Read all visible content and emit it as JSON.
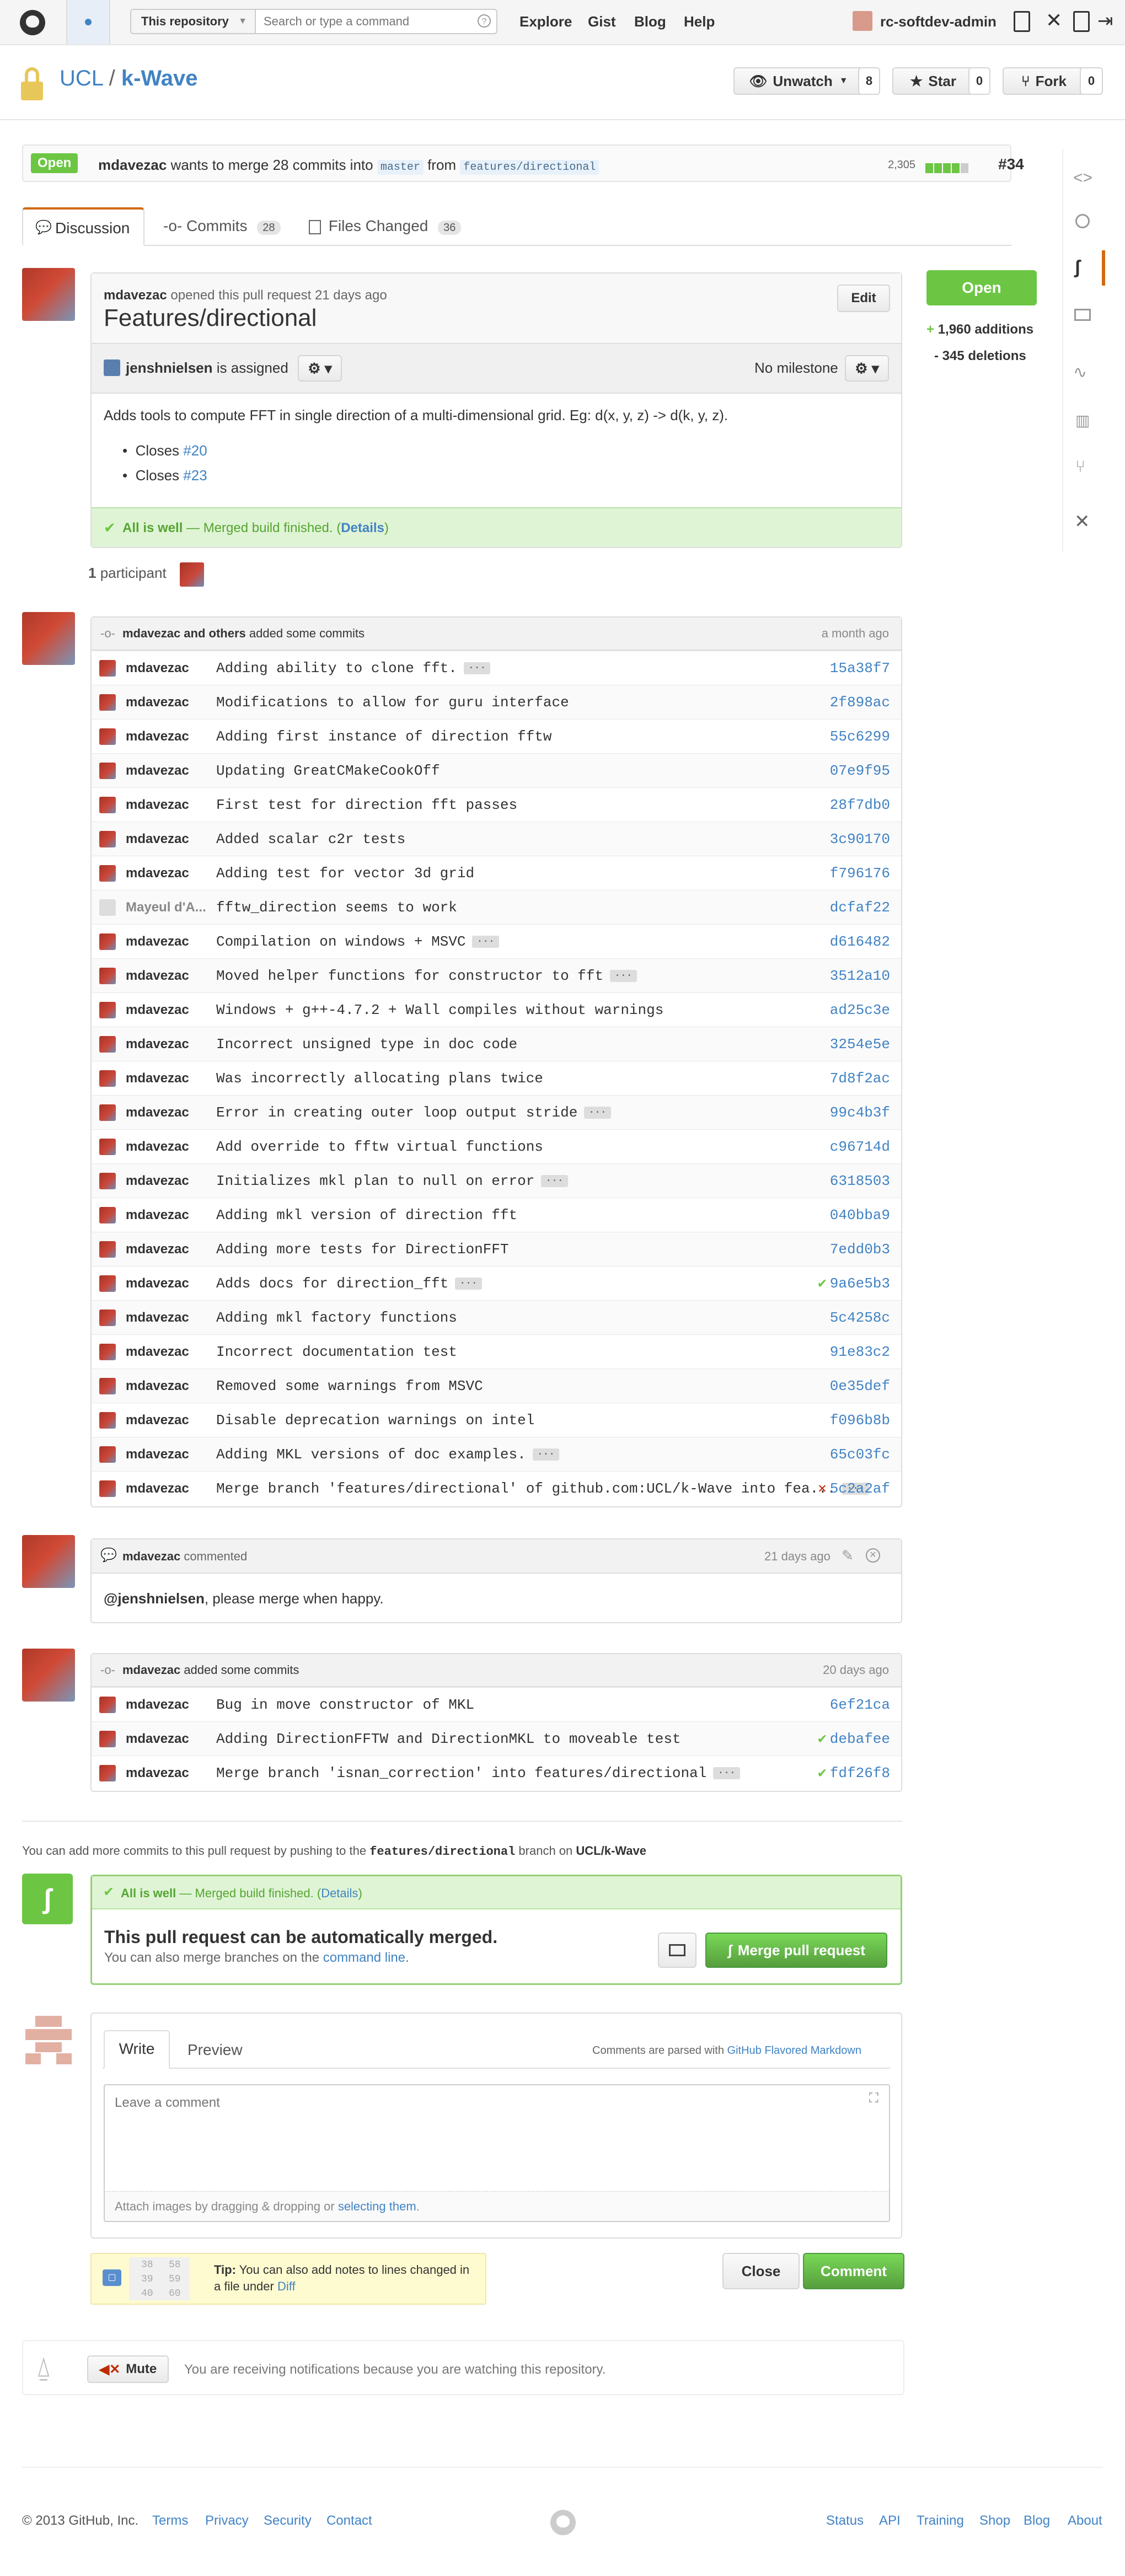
{
  "header": {
    "scope_label": "This repository",
    "search_placeholder": "Search or type a command",
    "nav": [
      "Explore",
      "Gist",
      "Blog",
      "Help"
    ],
    "username": "rc-softdev-admin"
  },
  "repo": {
    "owner": "UCL",
    "separator": "/",
    "name": "k-Wave",
    "unwatch_label": "Unwatch",
    "unwatch_count": "8",
    "star_label": "Star",
    "star_count": "0",
    "fork_label": "Fork",
    "fork_count": "0"
  },
  "pr_bar": {
    "state": "Open",
    "author": "mdavezac",
    "text_mid": "wants to merge 28 commits into",
    "base": "master",
    "from_text": "from",
    "head": "features/directional",
    "diff_count": "2,305",
    "number": "#34"
  },
  "tabs": {
    "discussion": "Discussion",
    "commits": "Commits",
    "commits_count": "28",
    "files": "Files Changed",
    "files_count": "36"
  },
  "opening": {
    "author": "mdavezac",
    "meta": "opened this pull request 21 days ago",
    "title": "Features/directional",
    "edit_label": "Edit",
    "assignee": "jenshnielsen",
    "assigned_text": "is assigned",
    "milestone": "No milestone",
    "body": "Adds tools to compute FFT in single direction of a multi-dimensional grid. Eg: d(x, y, z) -> d(k, y, z).",
    "closes": [
      {
        "prefix": "Closes",
        "ref": "#20"
      },
      {
        "prefix": "Closes",
        "ref": "#23"
      }
    ],
    "status_bold": "All is well",
    "status_text": "— Merged build finished. (",
    "status_link": "Details",
    "status_end": ")"
  },
  "side": {
    "state_button": "Open",
    "additions": "1,960 additions",
    "deletions": "- 345 deletions"
  },
  "participants": {
    "count": "1",
    "label": "participant"
  },
  "commit_group1": {
    "header": "mdavezac and others",
    "header_suffix": "added some commits",
    "time": "a month ago",
    "commits": [
      {
        "author": "mdavezac",
        "msg": "Adding ability to clone fft.",
        "sha": "15a38f7",
        "ell": true,
        "status": ""
      },
      {
        "author": "mdavezac",
        "msg": "Modifications to allow for guru interface",
        "sha": "2f898ac",
        "ell": false,
        "status": ""
      },
      {
        "author": "mdavezac",
        "msg": "Adding first instance of direction fftw",
        "sha": "55c6299",
        "ell": false,
        "status": ""
      },
      {
        "author": "mdavezac",
        "msg": "Updating GreatCMakeCookOff",
        "sha": "07e9f95",
        "ell": false,
        "status": ""
      },
      {
        "author": "mdavezac",
        "msg": "First test for direction fft passes",
        "sha": "28f7db0",
        "ell": false,
        "status": ""
      },
      {
        "author": "mdavezac",
        "msg": "Added scalar c2r tests",
        "sha": "3c90170",
        "ell": false,
        "status": ""
      },
      {
        "author": "mdavezac",
        "msg": "Adding test for vector 3d grid",
        "sha": "f796176",
        "ell": false,
        "status": ""
      },
      {
        "author": "Mayeul d'A...",
        "msg": "fftw_direction seems to work",
        "sha": "dcfaf22",
        "ell": false,
        "status": "",
        "gray": true
      },
      {
        "author": "mdavezac",
        "msg": "Compilation on windows + MSVC",
        "sha": "d616482",
        "ell": true,
        "status": ""
      },
      {
        "author": "mdavezac",
        "msg": "Moved helper functions for constructor to fft",
        "sha": "3512a10",
        "ell": true,
        "status": ""
      },
      {
        "author": "mdavezac",
        "msg": "Windows + g++-4.7.2 + Wall compiles without warnings",
        "sha": "ad25c3e",
        "ell": false,
        "status": ""
      },
      {
        "author": "mdavezac",
        "msg": "Incorrect unsigned type in doc code",
        "sha": "3254e5e",
        "ell": false,
        "status": ""
      },
      {
        "author": "mdavezac",
        "msg": "Was incorrectly allocating plans twice",
        "sha": "7d8f2ac",
        "ell": false,
        "status": ""
      },
      {
        "author": "mdavezac",
        "msg": "Error in creating outer loop output stride",
        "sha": "99c4b3f",
        "ell": true,
        "status": ""
      },
      {
        "author": "mdavezac",
        "msg": "Add override to fftw virtual functions",
        "sha": "c96714d",
        "ell": false,
        "status": ""
      },
      {
        "author": "mdavezac",
        "msg": "Initializes mkl plan to null on error",
        "sha": "6318503",
        "ell": true,
        "status": ""
      },
      {
        "author": "mdavezac",
        "msg": "Adding mkl version of direction fft",
        "sha": "040bba9",
        "ell": false,
        "status": ""
      },
      {
        "author": "mdavezac",
        "msg": "Adding more tests for DirectionFFT",
        "sha": "7edd0b3",
        "ell": false,
        "status": ""
      },
      {
        "author": "mdavezac",
        "msg": "Adds docs for direction_fft",
        "sha": "9a6e5b3",
        "ell": true,
        "status": "ok"
      },
      {
        "author": "mdavezac",
        "msg": "Adding mkl factory functions",
        "sha": "5c4258c",
        "ell": false,
        "status": ""
      },
      {
        "author": "mdavezac",
        "msg": "Incorrect documentation test",
        "sha": "91e83c2",
        "ell": false,
        "status": ""
      },
      {
        "author": "mdavezac",
        "msg": "Removed some warnings from MSVC",
        "sha": "0e35def",
        "ell": false,
        "status": ""
      },
      {
        "author": "mdavezac",
        "msg": "Disable deprecation warnings on intel",
        "sha": "f096b8b",
        "ell": false,
        "status": ""
      },
      {
        "author": "mdavezac",
        "msg": "Adding MKL versions of doc examples.",
        "sha": "65c03fc",
        "ell": true,
        "status": ""
      },
      {
        "author": "mdavezac",
        "msg": "Merge branch 'features/directional' of github.com:UCL/k-Wave into fea...",
        "sha": "5c2a2af",
        "ell": true,
        "status": "fail"
      }
    ]
  },
  "comment": {
    "author": "mdavezac",
    "action": "commented",
    "time": "21 days ago",
    "mention": "@jenshnielsen",
    "body": ", please merge when happy."
  },
  "commit_group2": {
    "header": "mdavezac",
    "header_suffix": "added some commits",
    "time": "20 days ago",
    "commits": [
      {
        "author": "mdavezac",
        "msg": "Bug in move constructor of MKL",
        "sha": "6ef21ca",
        "ell": false,
        "status": ""
      },
      {
        "author": "mdavezac",
        "msg": "Adding DirectionFFTW and DirectionMKL to moveable test",
        "sha": "debafee",
        "ell": false,
        "status": "ok"
      },
      {
        "author": "mdavezac",
        "msg": "Merge branch 'isnan_correction' into features/directional",
        "sha": "fdf26f8",
        "ell": true,
        "status": "ok"
      }
    ]
  },
  "merge": {
    "hint_pre": "You can add more commits to this pull request by pushing to the",
    "hint_branch": "features/directional",
    "hint_mid": "branch on",
    "hint_repo": "UCL/k-Wave",
    "status_bold": "All is well",
    "status_text": "— Merged build finished. (",
    "status_link": "Details",
    "status_end": ")",
    "title": "This pull request can be automatically merged.",
    "sub_pre": "You can also merge branches on the",
    "sub_link": "command line",
    "sub_end": ".",
    "merge_button": "Merge pull request"
  },
  "composer": {
    "tab_write": "Write",
    "tab_preview": "Preview",
    "parsed_text": "Comments are parsed with",
    "parsed_link": "GitHub Flavored Markdown",
    "placeholder": "Leave a comment",
    "attach_pre": "Attach images by dragging & dropping or",
    "attach_link": "selecting them",
    "attach_end": ".",
    "tip_bold": "Tip:",
    "tip_text": "You can also add notes to lines changed in a file under",
    "tip_link": "Diff",
    "tip_lines": [
      "38",
      "58",
      "39",
      "59",
      "40",
      "60"
    ],
    "close_label": "Close",
    "comment_label": "Comment"
  },
  "notifications": {
    "mute_label": "Mute",
    "text": "You are receiving notifications because you are watching this repository."
  },
  "footer": {
    "copyright": "© 2013 GitHub, Inc.",
    "left_links": [
      "Terms",
      "Privacy",
      "Security",
      "Contact"
    ],
    "right_links": [
      "Status",
      "API",
      "Training",
      "Shop",
      "Blog",
      "About"
    ]
  },
  "colors": {
    "green": "#6cc644",
    "link": "#4183c4",
    "active_tab_accent": "#d26911",
    "fail": "#bd2c00"
  }
}
